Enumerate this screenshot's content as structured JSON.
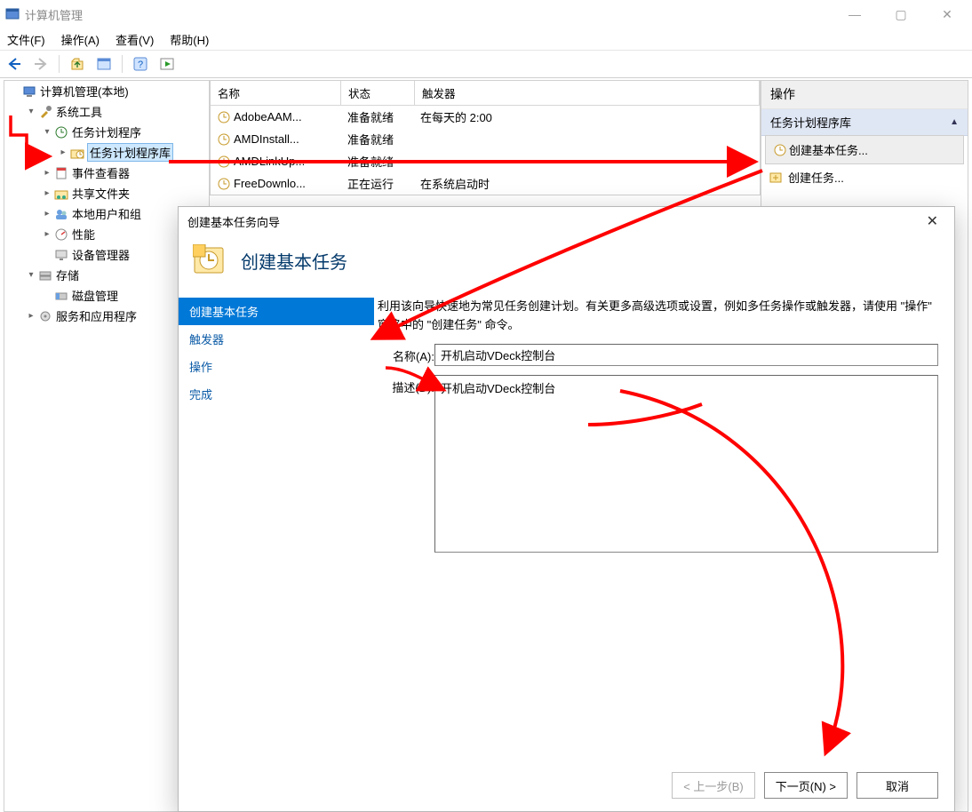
{
  "window": {
    "title": "计算机管理",
    "btn_min": "—",
    "btn_max": "▢",
    "btn_close": "✕"
  },
  "menus": {
    "file": "文件(F)",
    "action": "操作(A)",
    "view": "查看(V)",
    "help": "帮助(H)"
  },
  "tree": {
    "root": "计算机管理(本地)",
    "sys": "系统工具",
    "sched": "任务计划程序",
    "sched_lib": "任务计划程序库",
    "evt": "事件查看器",
    "share": "共享文件夹",
    "users": "本地用户和组",
    "perf": "性能",
    "devmgr": "设备管理器",
    "storage": "存储",
    "diskmgmt": "磁盘管理",
    "services": "服务和应用程序"
  },
  "tasklist": {
    "cols": {
      "name": "名称",
      "state": "状态",
      "trigger": "触发器"
    },
    "rows": [
      {
        "name": "AdobeAAM...",
        "state": "准备就绪",
        "trigger": "在每天的 2:00"
      },
      {
        "name": "AMDInstall...",
        "state": "准备就绪",
        "trigger": ""
      },
      {
        "name": "AMDLinkUp...",
        "state": "准备就绪",
        "trigger": ""
      },
      {
        "name": "FreeDownlo...",
        "state": "正在运行",
        "trigger": "在系统启动时"
      }
    ]
  },
  "actions": {
    "title": "操作",
    "group": "任务计划程序库",
    "create_basic": "创建基本任务...",
    "create": "创建任务..."
  },
  "wizard": {
    "title": "创建基本任务向导",
    "heading": "创建基本任务",
    "steps": {
      "basic": "创建基本任务",
      "trigger": "触发器",
      "action": "操作",
      "finish": "完成"
    },
    "description": "利用该向导快速地为常见任务创建计划。有关更多高级选项或设置，例如多任务操作或触发器，请使用 \"操作\" 窗格中的 \"创建任务\" 命令。",
    "name_label": "名称(A):",
    "name_value": "开机启动VDeck控制台",
    "desc_label": "描述(D):",
    "desc_value": "开机启动VDeck控制台",
    "btn_back": "< 上一步(B)",
    "btn_next": "下一页(N) >",
    "btn_cancel": "取消"
  }
}
